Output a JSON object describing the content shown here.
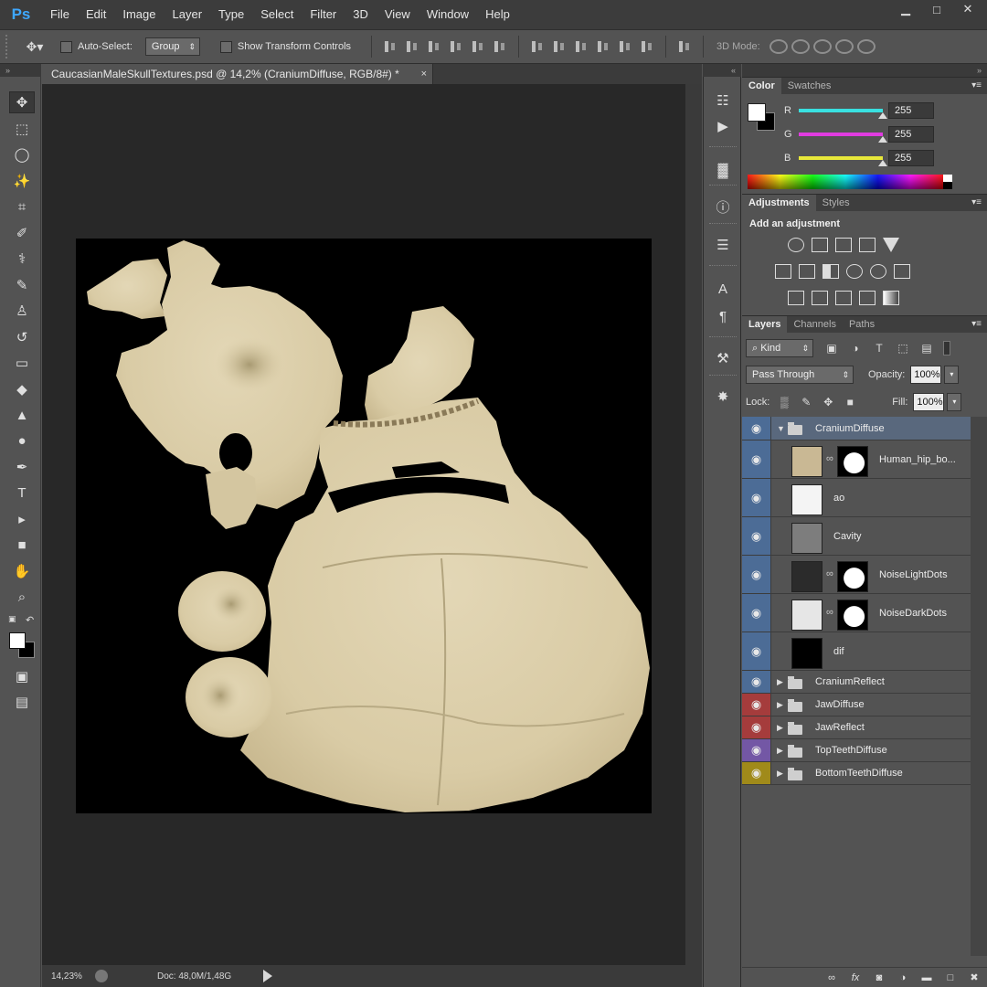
{
  "app": {
    "logo": "Ps"
  },
  "menu": [
    "File",
    "Edit",
    "Image",
    "Layer",
    "Type",
    "Select",
    "Filter",
    "3D",
    "View",
    "Window",
    "Help"
  ],
  "window_controls": {
    "minimize": "▁",
    "maximize": "□",
    "close": "✕"
  },
  "options_bar": {
    "auto_select_label": "Auto-Select:",
    "auto_select_target": "Group",
    "transform_controls_label": "Show Transform Controls",
    "mode_label": "3D Mode:"
  },
  "collapse_arrows": {
    "toolbox": "»",
    "dock": "«",
    "panels": "»"
  },
  "document": {
    "tab_title": "CaucasianMaleSkullTextures.psd @ 14,2% (CraniumDiffuse, RGB/8#) *",
    "tab_close": "×"
  },
  "status": {
    "zoom": "14,23%",
    "doc_info": "Doc: 48,0M/1,48G"
  },
  "tools": [
    {
      "name": "move-tool-icon",
      "glyph": "✥"
    },
    {
      "name": "marquee-tool-icon",
      "glyph": "⬚"
    },
    {
      "name": "lasso-tool-icon",
      "glyph": "◯"
    },
    {
      "name": "magic-wand-tool-icon",
      "glyph": "✨"
    },
    {
      "name": "crop-tool-icon",
      "glyph": "⌗"
    },
    {
      "name": "eyedropper-tool-icon",
      "glyph": "✐"
    },
    {
      "name": "healing-brush-tool-icon",
      "glyph": "⚕"
    },
    {
      "name": "brush-tool-icon",
      "glyph": "✎"
    },
    {
      "name": "clone-stamp-tool-icon",
      "glyph": "♙"
    },
    {
      "name": "history-brush-tool-icon",
      "glyph": "↺"
    },
    {
      "name": "eraser-tool-icon",
      "glyph": "▭"
    },
    {
      "name": "paint-bucket-tool-icon",
      "glyph": "◆"
    },
    {
      "name": "blur-tool-icon",
      "glyph": "▲"
    },
    {
      "name": "dodge-tool-icon",
      "glyph": "●"
    },
    {
      "name": "pen-tool-icon",
      "glyph": "✒"
    },
    {
      "name": "type-tool-icon",
      "glyph": "T"
    },
    {
      "name": "path-selection-tool-icon",
      "glyph": "▸"
    },
    {
      "name": "rectangle-tool-icon",
      "glyph": "■"
    },
    {
      "name": "hand-tool-icon",
      "glyph": "✋"
    },
    {
      "name": "zoom-tool-icon",
      "glyph": "⌕"
    }
  ],
  "dock_icons": [
    {
      "name": "history-panel-icon",
      "glyph": "☷"
    },
    {
      "name": "actions-panel-icon",
      "glyph": "▶"
    },
    {
      "name": "histogram-panel-icon",
      "glyph": "▓"
    },
    {
      "name": "info-panel-icon",
      "glyph": "ⓘ"
    },
    {
      "name": "properties-panel-icon",
      "glyph": "☰"
    },
    {
      "name": "character-panel-icon",
      "glyph": "A"
    },
    {
      "name": "paragraph-panel-icon",
      "glyph": "¶"
    },
    {
      "name": "tool-presets-panel-icon",
      "glyph": "⚒"
    },
    {
      "name": "3d-panel-icon",
      "glyph": "✸"
    }
  ],
  "color_panel": {
    "tabs": [
      "Color",
      "Swatches"
    ],
    "channels": [
      {
        "letter": "R",
        "value": "255",
        "color": "#39e0e0"
      },
      {
        "letter": "G",
        "value": "255",
        "color": "#e03ce0"
      },
      {
        "letter": "B",
        "value": "255",
        "color": "#e8e83a"
      }
    ],
    "menu": "▾≡"
  },
  "adjustments_panel": {
    "tabs": [
      "Adjustments",
      "Styles"
    ],
    "title": "Add an adjustment"
  },
  "layers_panel": {
    "tabs": [
      "Layers",
      "Channels",
      "Paths"
    ],
    "filter_kind": "Kind",
    "blend_mode": "Pass Through",
    "opacity_label": "Opacity:",
    "opacity": "100%",
    "lock_label": "Lock:",
    "fill_label": "Fill:",
    "fill": "100%",
    "layers": [
      {
        "name": "CraniumDiffuse",
        "kind": "group-open",
        "tag": "blue",
        "selected": true
      },
      {
        "name": "Human_hip_bo...",
        "kind": "layer",
        "tag": "blue",
        "mask": true,
        "thumb": "texture"
      },
      {
        "name": "ao",
        "kind": "layer",
        "tag": "blue",
        "mask": false,
        "thumb": "white"
      },
      {
        "name": "Cavity",
        "kind": "layer",
        "tag": "blue",
        "mask": false,
        "thumb": "gray"
      },
      {
        "name": "NoiseLightDots",
        "kind": "layer",
        "tag": "blue",
        "mask": true,
        "thumb": "dark"
      },
      {
        "name": "NoiseDarkDots",
        "kind": "layer",
        "tag": "blue",
        "mask": true,
        "thumb": "light"
      },
      {
        "name": "dif",
        "kind": "layer",
        "tag": "blue",
        "mask": false,
        "thumb": "dif"
      },
      {
        "name": "CraniumReflect",
        "kind": "group",
        "tag": "blue"
      },
      {
        "name": "JawDiffuse",
        "kind": "group",
        "tag": "red"
      },
      {
        "name": "JawReflect",
        "kind": "group",
        "tag": "red"
      },
      {
        "name": "TopTeethDiffuse",
        "kind": "group",
        "tag": "violet"
      },
      {
        "name": "BottomTeethDiffuse",
        "kind": "group",
        "tag": "yellow"
      }
    ]
  }
}
